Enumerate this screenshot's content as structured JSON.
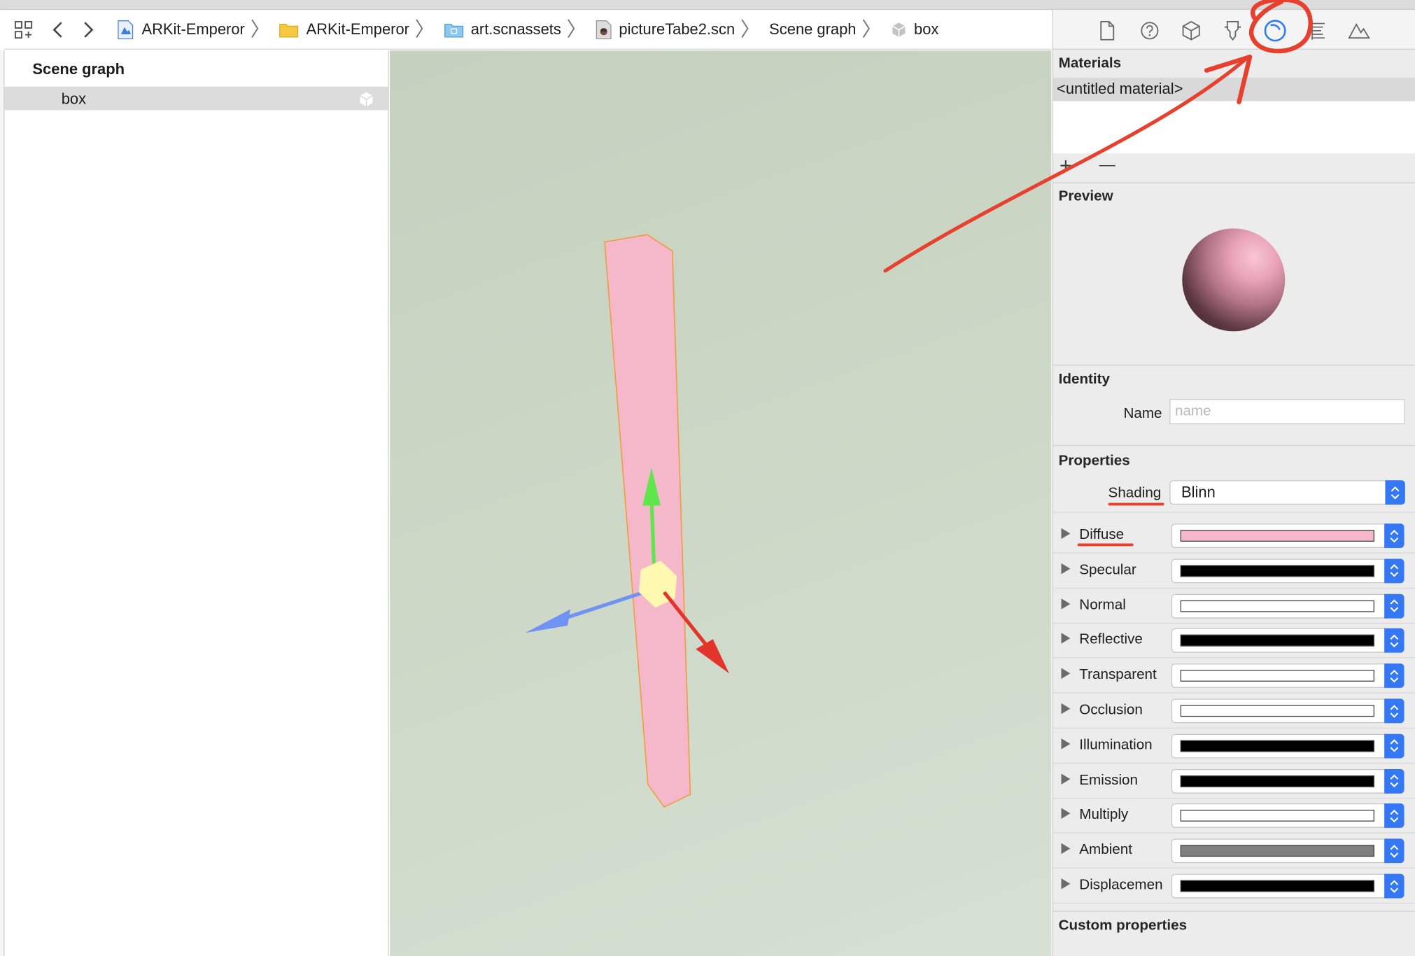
{
  "jumpbar": {
    "crumbs": [
      {
        "label": "ARKit-Emperor",
        "icon": "project-icon"
      },
      {
        "label": "ARKit-Emperor",
        "icon": "folder-icon"
      },
      {
        "label": "art.scnassets",
        "icon": "scnassets-folder-icon"
      },
      {
        "label": "pictureTabe2.scn",
        "icon": "scene-file-icon"
      },
      {
        "label": "Scene graph",
        "icon": ""
      },
      {
        "label": "box",
        "icon": "box-node-icon"
      }
    ]
  },
  "outline": {
    "title": "Scene graph",
    "items": [
      {
        "label": "box"
      }
    ]
  },
  "inspector": {
    "tabs": [
      "file-inspector-icon",
      "help-inspector-icon",
      "node-inspector-icon",
      "attributes-inspector-icon",
      "material-inspector-icon",
      "physics-inspector-icon",
      "scene-inspector-icon"
    ],
    "active_tab": "material-inspector-icon",
    "materials": {
      "title": "Materials",
      "items": [
        "<untitled material>"
      ],
      "add": "+",
      "remove": "—"
    },
    "preview": {
      "title": "Preview"
    },
    "identity": {
      "title": "Identity",
      "name_label": "Name",
      "name_value": "",
      "name_placeholder": "name"
    },
    "properties": {
      "title": "Properties",
      "shading_label": "Shading",
      "shading_value": "Blinn",
      "rows": [
        {
          "label": "Diffuse",
          "color": "#f4b8ca"
        },
        {
          "label": "Specular",
          "color": "#000000"
        },
        {
          "label": "Normal",
          "color": "#ffffff"
        },
        {
          "label": "Reflective",
          "color": "#000000"
        },
        {
          "label": "Transparent",
          "color": "#ffffff"
        },
        {
          "label": "Occlusion",
          "color": "#ffffff"
        },
        {
          "label": "Illumination",
          "color": "#000000"
        },
        {
          "label": "Emission",
          "color": "#000000"
        },
        {
          "label": "Multiply",
          "color": "#ffffff"
        },
        {
          "label": "Ambient",
          "color": "#808080"
        },
        {
          "label": "Displacemen",
          "color": "#000000"
        }
      ]
    },
    "custom_properties": {
      "title": "Custom properties"
    }
  },
  "viewport": {
    "background": "#c9d4c3",
    "box_color": "#f4b8ca",
    "box_outline": "#f29a3a",
    "gizmo": {
      "x_axis": "#e3342b",
      "y_axis": "#5fe64a",
      "z_axis": "#6f93f2",
      "center": "#fff8b0"
    }
  },
  "annotations": {
    "color": "#e8402e"
  }
}
